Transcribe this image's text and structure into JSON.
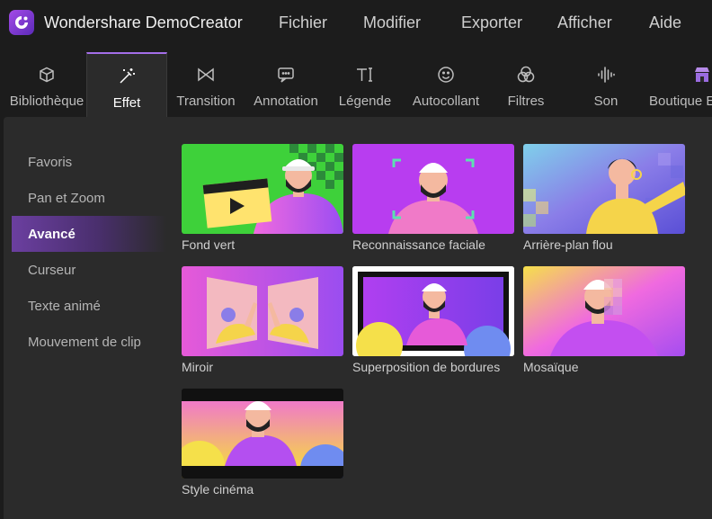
{
  "app": {
    "title": "Wondershare DemoCreator"
  },
  "menu": [
    "Fichier",
    "Modifier",
    "Exporter",
    "Afficher",
    "Aide"
  ],
  "toolbar": [
    {
      "label": "Bibliothèque",
      "icon": "cube-icon"
    },
    {
      "label": "Effet",
      "icon": "magic-wand-icon",
      "active": true
    },
    {
      "label": "Transition",
      "icon": "bowtie-icon"
    },
    {
      "label": "Annotation",
      "icon": "speech-bubble-icon"
    },
    {
      "label": "Légende",
      "icon": "text-cursor-icon"
    },
    {
      "label": "Autocollant",
      "icon": "smiley-icon"
    },
    {
      "label": "Filtres",
      "icon": "circles-icon"
    },
    {
      "label": "Son",
      "icon": "waveform-icon"
    },
    {
      "label": "Boutique E",
      "icon": "shop-icon"
    }
  ],
  "sidebar": [
    {
      "label": "Favoris"
    },
    {
      "label": "Pan et Zoom"
    },
    {
      "label": "Avancé",
      "active": true
    },
    {
      "label": "Curseur"
    },
    {
      "label": "Texte animé"
    },
    {
      "label": "Mouvement de clip"
    }
  ],
  "effects": [
    {
      "label": "Fond vert"
    },
    {
      "label": "Reconnaissance faciale"
    },
    {
      "label": "Arrière-plan flou"
    },
    {
      "label": "Miroir"
    },
    {
      "label": "Superposition de bordures"
    },
    {
      "label": "Mosaïque"
    },
    {
      "label": "Style cinéma"
    }
  ],
  "colors": {
    "accent": "#a46ee8",
    "panel": "#2b2b2b",
    "background": "#1c1c1c"
  }
}
